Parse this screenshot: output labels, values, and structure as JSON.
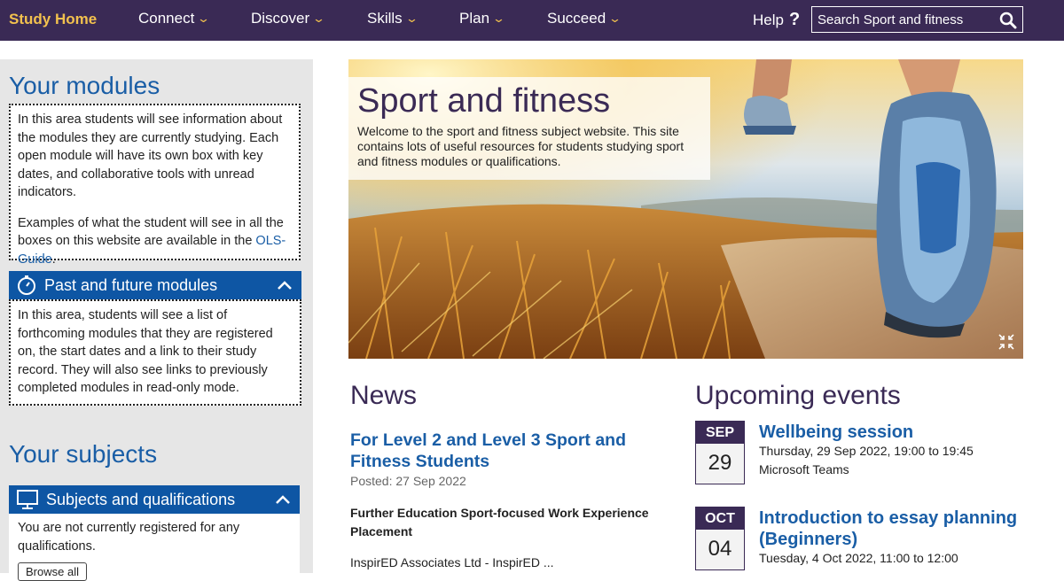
{
  "nav": {
    "brand": "Study Home",
    "items": [
      {
        "label": "Connect"
      },
      {
        "label": "Discover"
      },
      {
        "label": "Skills"
      },
      {
        "label": "Plan"
      },
      {
        "label": "Succeed"
      }
    ],
    "help": "Help",
    "help_mark": "?",
    "search_placeholder": "Search Sport and fitness"
  },
  "left": {
    "modules_heading": "Your modules",
    "modules_p1": "In this area students will see information about the modules they are currently studying. Each open module will have its own box with key dates, and collaborative tools with unread indicators.",
    "modules_p2_before": "Examples of what the student will see in all the boxes on this website are available in the ",
    "modules_p2_link": "OLS-Guide",
    "modules_p2_after": ".",
    "past_future": {
      "title": "Past and future modules",
      "text": "In this area, students will see a list of forthcoming modules that they are registered on, the start dates and a link to their study record. They will also see links to previously completed modules in read-only mode."
    },
    "subjects_heading": "Your subjects",
    "subjects": {
      "title": "Subjects and qualifications",
      "text": "You are not currently registered for any qualifications.",
      "browse_label": "Browse all"
    }
  },
  "hero": {
    "title": "Sport and fitness",
    "text": "Welcome to the sport and fitness subject website. This site contains lots of useful resources for students studying sport and fitness modules or qualifications."
  },
  "news": {
    "heading": "News",
    "title": "For Level 2 and Level 3 Sport and Fitness Students",
    "posted": "Posted: 27 Sep 2022",
    "subtitle": "Further Education Sport-focused Work Experience Placement",
    "snippet": "InspirED Associates Ltd - InspirED ..."
  },
  "events": {
    "heading": "Upcoming events",
    "items": [
      {
        "month": "SEP",
        "day": "29",
        "title": "Wellbeing session",
        "time": "Thursday, 29 Sep 2022, 19:00 to 19:45",
        "location": "Microsoft Teams"
      },
      {
        "month": "OCT",
        "day": "04",
        "title": "Introduction to essay planning (Beginners)",
        "time": "Tuesday, 4 Oct 2022, 11:00 to 12:00"
      }
    ]
  },
  "colors": {
    "nav_bg": "#3a2a55",
    "brand": "#f2c14e",
    "link_blue": "#1a5ea6",
    "bar_blue": "#0e56a4",
    "left_bg": "#e6e6e6"
  }
}
